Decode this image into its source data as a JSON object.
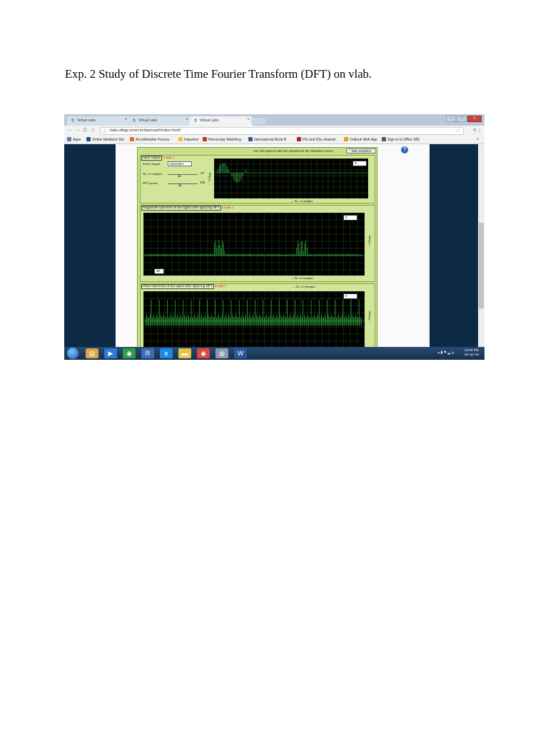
{
  "document": {
    "heading": "Exp. 2 Study of Discrete Time Fourier Transform (DFT) on vlab."
  },
  "browser": {
    "tabs": [
      {
        "label": "Virtual Labs"
      },
      {
        "label": "Virtual Labs"
      },
      {
        "label": "Virtual Labs"
      }
    ],
    "tab_close": "×",
    "window_buttons": {
      "minimize": "–",
      "maximize": "□",
      "close": "×"
    },
    "nav": {
      "back": "←",
      "forward": "→",
      "reload": "C",
      "home": "⌂"
    },
    "url": "vlabs.iitkgp.ernet.in/dsp/exp5/index.html#",
    "url_lock": "ⓘ",
    "star": "☆",
    "toolbar_right": "K ⋮",
    "bookmarks": [
      {
        "label": "Apps",
        "color": "#5a7fb0"
      },
      {
        "label": "Online Medicine Sto",
        "color": "#1d4f91"
      },
      {
        "label": "AccuWeather Foreca",
        "color": "#e36b1a"
      },
      {
        "label": "Imported",
        "color": "#f1c232"
      },
      {
        "label": "Horoscope Matching",
        "color": "#c0392b"
      },
      {
        "label": "International Book R",
        "color": "#3b5998"
      },
      {
        "label": "IITs and IISc elearnin",
        "color": "#b22222"
      },
      {
        "label": "Outlook Web App",
        "color": "#e8a000"
      },
      {
        "label": "Sign in to Office 365",
        "color": "#555555"
      }
    ],
    "bookmarks_more": "»"
  },
  "simulation": {
    "hint": "Use this button to take the snapshot of the simulation screen",
    "snapshot_button": "Take Snapshot",
    "help": "?",
    "graph1": {
      "title": "Input Signal",
      "graph_label": "Graph 1",
      "select_label": "Select Signal",
      "select_value": "Sinusoid",
      "samples_label": "No. of samples",
      "samples_value": "20",
      "dft_label": "DFT points",
      "dft_value": "100",
      "ylabel": "Voltage",
      "xlabel": "No. of samples",
      "readout": "0"
    },
    "graph2": {
      "title": "Magnitude Spectrum of the signal after applying DFT",
      "graph_label": "Graph 2",
      "ylabel": "Voltage",
      "xlabel": "No. of samples",
      "readout": "0",
      "marker": "20"
    },
    "graph3": {
      "title": "Phase Spectrum of the signal after applying DFT",
      "graph_label": "Graph 3",
      "ylabel": "Voltage",
      "xlabel": "No. of Samples",
      "readout": "0"
    }
  },
  "taskbar": {
    "icons": [
      {
        "glyph": "▤",
        "color": "#d9a441"
      },
      {
        "glyph": "▶",
        "color": "#2a7bd6"
      },
      {
        "glyph": "◉",
        "color": "#2e9e46"
      },
      {
        "glyph": "R",
        "color": "#3b6fb5"
      },
      {
        "glyph": "e",
        "color": "#1e88e5"
      },
      {
        "glyph": "▬",
        "color": "#e8c547"
      },
      {
        "glyph": "◉",
        "color": "#e0463a"
      },
      {
        "glyph": "◍",
        "color": "#8a9bb0"
      },
      {
        "glyph": "W",
        "color": "#2b579a"
      }
    ],
    "tray": "▴ ▮ ⚑ ▂ 🔈",
    "time": "10:00 PM",
    "date": "15-Apr-18"
  }
}
